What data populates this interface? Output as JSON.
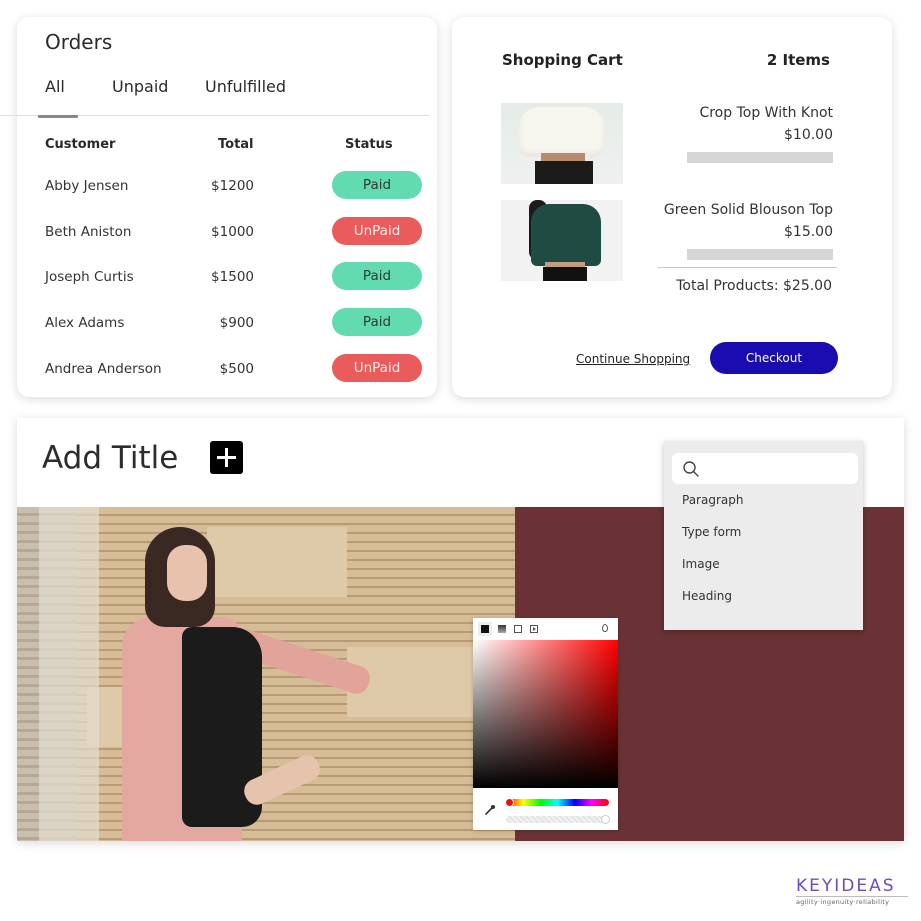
{
  "orders": {
    "title": "Orders",
    "tabs": [
      {
        "label": "All",
        "active": true
      },
      {
        "label": "Unpaid",
        "active": false
      },
      {
        "label": "Unfulfilled",
        "active": false
      }
    ],
    "columns": [
      "Customer",
      "Total",
      "Status"
    ],
    "rows": [
      {
        "customer": "Abby Jensen",
        "total": "$1200",
        "status": "Paid"
      },
      {
        "customer": "Beth Aniston",
        "total": "$1000",
        "status": "UnPaid"
      },
      {
        "customer": "Joseph Curtis",
        "total": "$1500",
        "status": "Paid"
      },
      {
        "customer": "Alex Adams",
        "total": "$900",
        "status": "Paid"
      },
      {
        "customer": "Andrea Anderson",
        "total": "$500",
        "status": "UnPaid"
      }
    ],
    "status_colors": {
      "Paid": "#63dbb0",
      "UnPaid": "#ea5c5c"
    }
  },
  "cart": {
    "title": "Shopping Cart",
    "count": "2 Items",
    "items": [
      {
        "name": "Crop Top With Knot",
        "price": "$10.00",
        "image": "white-crop-top-photo"
      },
      {
        "name": "Green Solid Blouson Top",
        "price": "$15.00",
        "image": "green-blouson-top-photo"
      }
    ],
    "total": "Total Products: $25.00",
    "continue_label": "Continue Shopping",
    "checkout_label": "Checkout",
    "accent": "#1b0cb0"
  },
  "editor": {
    "title": "Add Title",
    "add_icon": "plus-icon",
    "hero_image": "woman-in-pink-coat-photo",
    "panel_color": "#6a3234",
    "block_menu": {
      "search_placeholder": "",
      "items": [
        "Paragraph",
        "Type form",
        "Image",
        "Heading"
      ]
    },
    "color_picker": {
      "modes": [
        "solid-icon",
        "gradient-icon",
        "image-icon",
        "video-icon"
      ],
      "selected_mode": "solid-icon",
      "hue_color": "#ff0000",
      "opacity_icon": "drop-icon",
      "eyedropper_icon": "eyedropper-icon"
    }
  },
  "logo": {
    "wordmark": "KEYIDEAS",
    "tagline": "agility·ingenuity·reliability"
  }
}
